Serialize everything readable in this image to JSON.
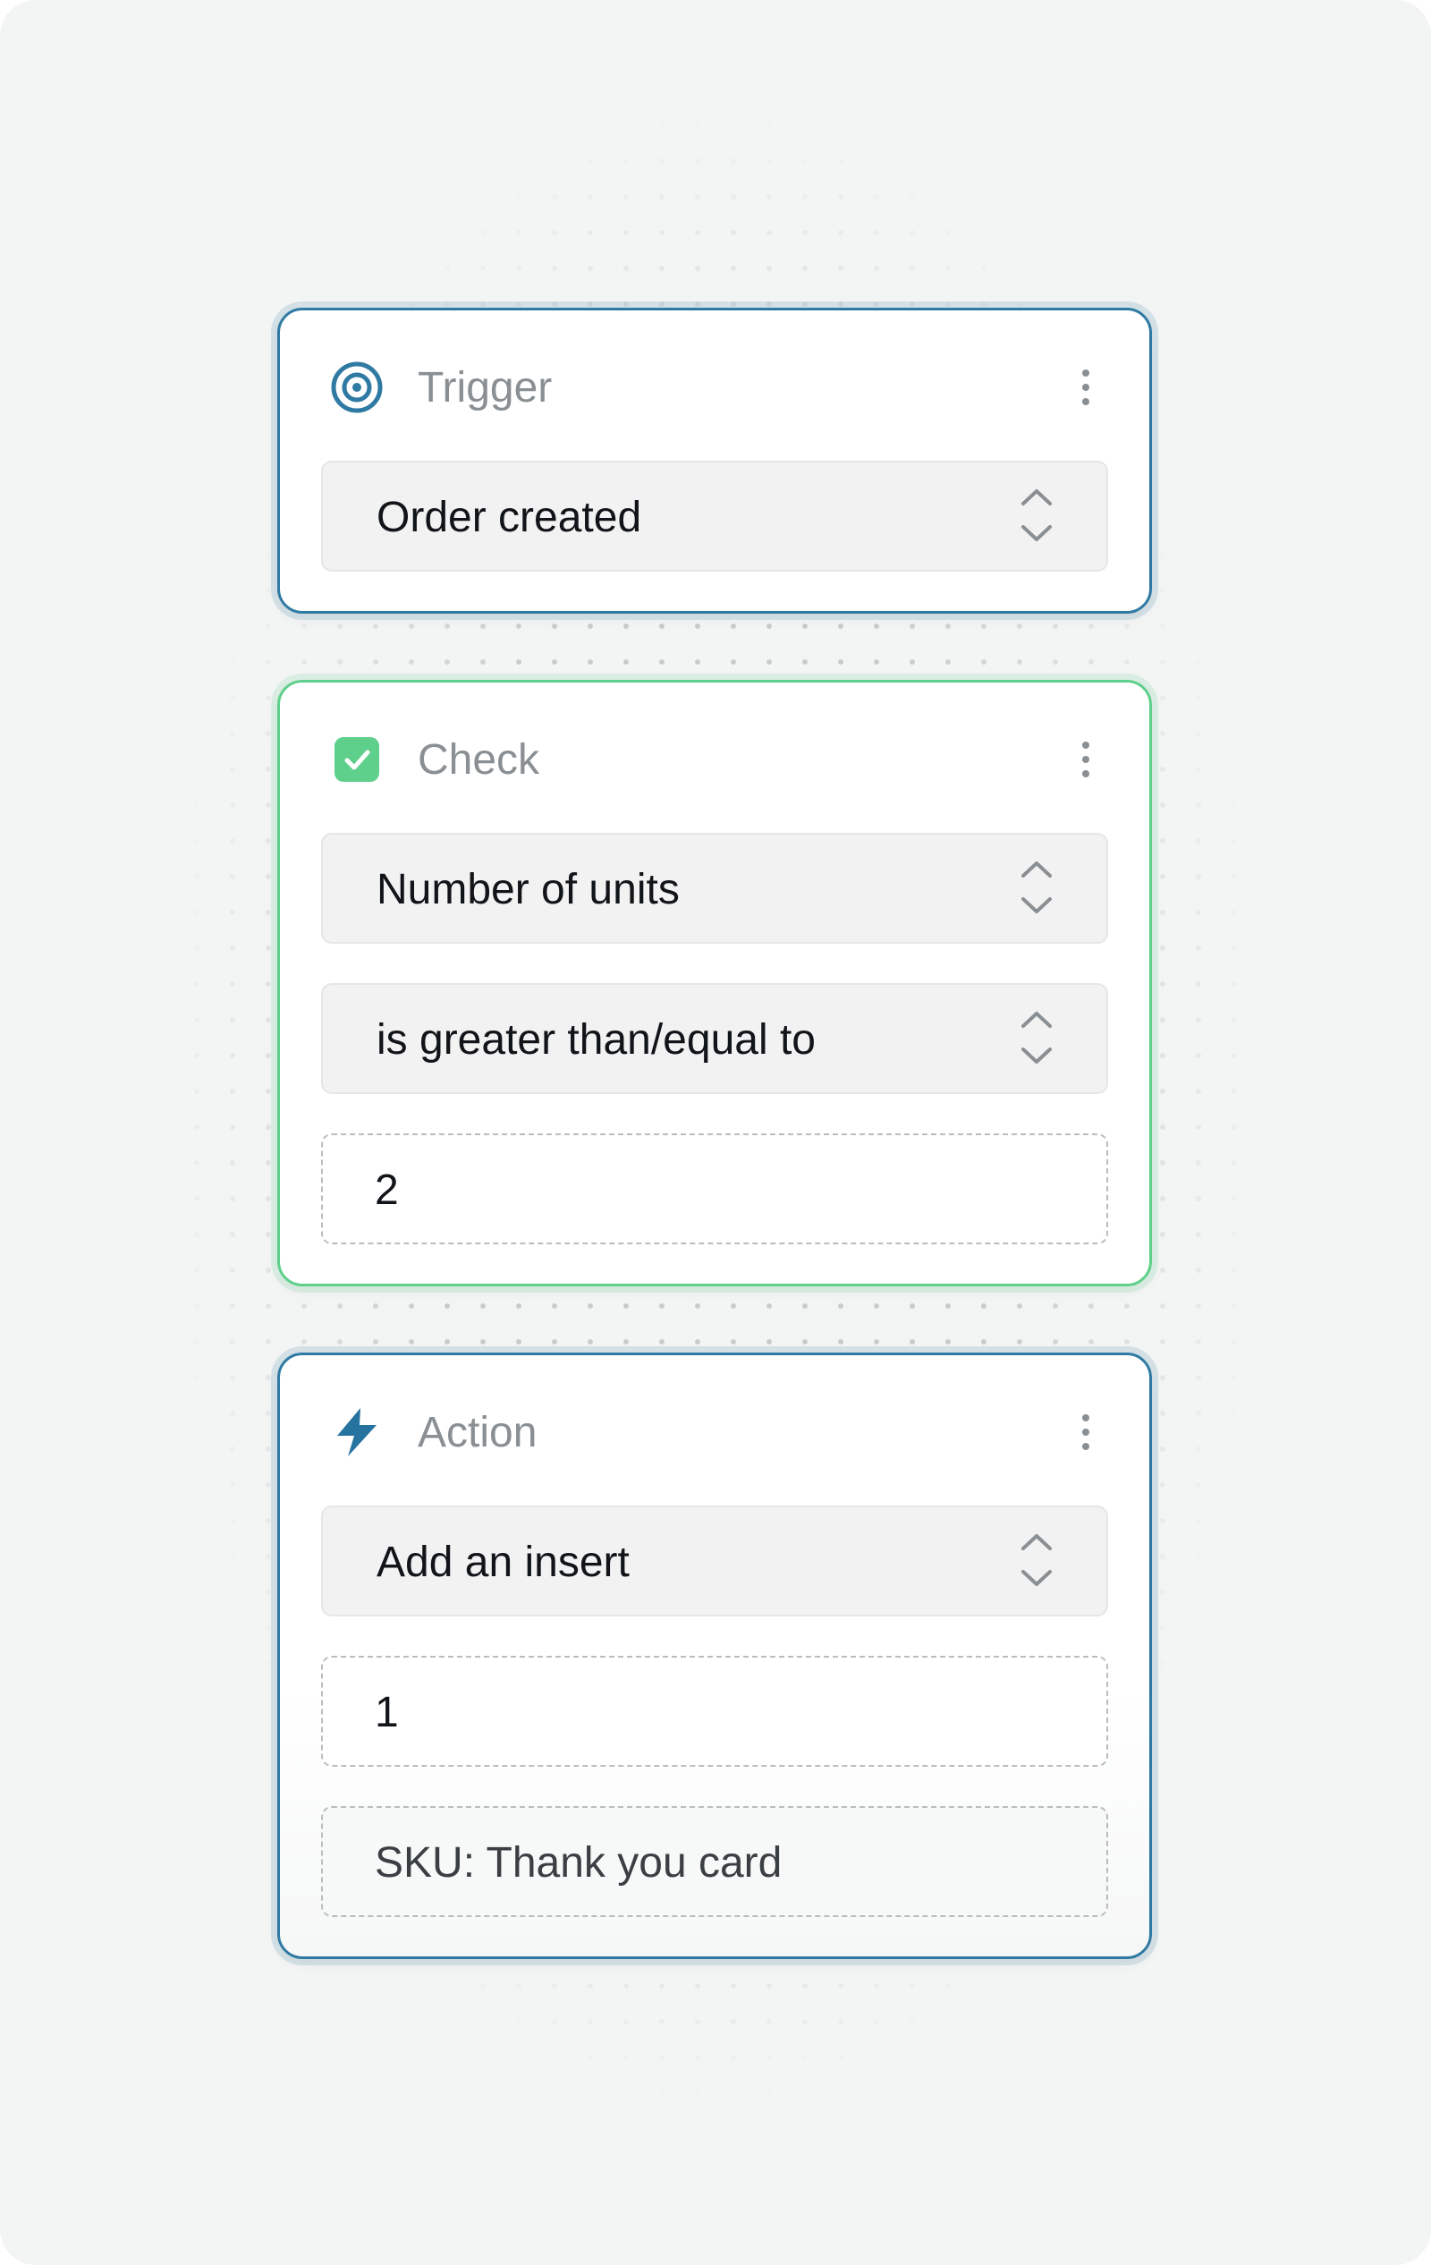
{
  "colors": {
    "accent_blue": "#2f7aa3",
    "accent_green": "#5fd08b",
    "field_bg": "#f2f2f2",
    "title_gray": "#8a8f93"
  },
  "trigger": {
    "title": "Trigger",
    "icon": "target-icon",
    "event_select": "Order created"
  },
  "check": {
    "title": "Check",
    "icon": "checkbox-checked-icon",
    "field_select": "Number of units",
    "operator_select": "is greater than/equal to",
    "value_input": "2"
  },
  "action": {
    "title": "Action",
    "icon": "lightning-icon",
    "action_select": "Add an insert",
    "quantity_input": "1",
    "sku_input": "SKU: Thank you card"
  }
}
